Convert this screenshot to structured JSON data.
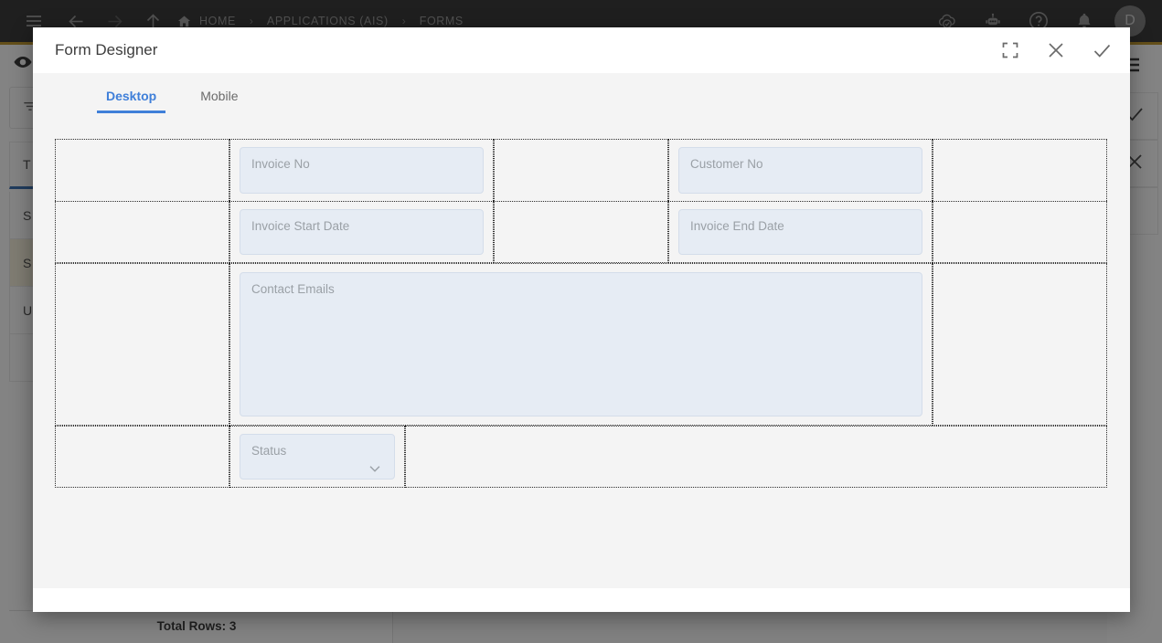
{
  "topbar": {
    "icons": {
      "menu": "hamburger-icon",
      "back": "arrow-left-icon",
      "forward": "arrow-right-icon",
      "up": "arrow-up-icon",
      "home": "home-icon",
      "cloud": "cloud-check-icon",
      "bot": "robot-icon",
      "help": "help-circle-icon",
      "bell": "bell-icon"
    },
    "breadcrumbs": [
      {
        "label": "HOME"
      },
      {
        "label": "APPLICATIONS (AIS)"
      },
      {
        "label": "FORMS"
      }
    ],
    "separator": "›",
    "avatar_initial": "D"
  },
  "background": {
    "eye_icon": "eye-icon",
    "filter_icon": "filter-icon",
    "list_items": [
      {
        "label": "T"
      },
      {
        "label": "S"
      },
      {
        "label": "S"
      },
      {
        "label": "U"
      }
    ],
    "total_rows": "Total Rows: 3",
    "right_rail": {
      "menu_icon": "hamburger-icon",
      "confirm_icon": "check-icon",
      "cancel_icon": "close-icon"
    }
  },
  "dialog": {
    "title": "Form Designer",
    "actions": {
      "expand": "expand-icon",
      "close": "close-icon",
      "confirm": "check-icon"
    },
    "tabs": [
      {
        "label": "Desktop",
        "active": true
      },
      {
        "label": "Mobile",
        "active": false
      }
    ],
    "accent_color": "#3f7fd9",
    "field_bg_color": "#e6ecf4",
    "placeholder_color": "#9aa0a6",
    "form": {
      "rows": [
        {
          "fields": [
            {
              "placeholder": "Invoice No",
              "type": "text"
            },
            {
              "placeholder": "Customer No",
              "type": "text"
            }
          ]
        },
        {
          "fields": [
            {
              "placeholder": "Invoice Start Date",
              "type": "text"
            },
            {
              "placeholder": "Invoice End Date",
              "type": "text"
            }
          ]
        },
        {
          "fields": [
            {
              "placeholder": "Contact Emails",
              "type": "textarea"
            }
          ]
        },
        {
          "fields": [
            {
              "placeholder": "Status",
              "type": "select",
              "chevron": "chevron-down-icon"
            }
          ]
        }
      ]
    }
  }
}
